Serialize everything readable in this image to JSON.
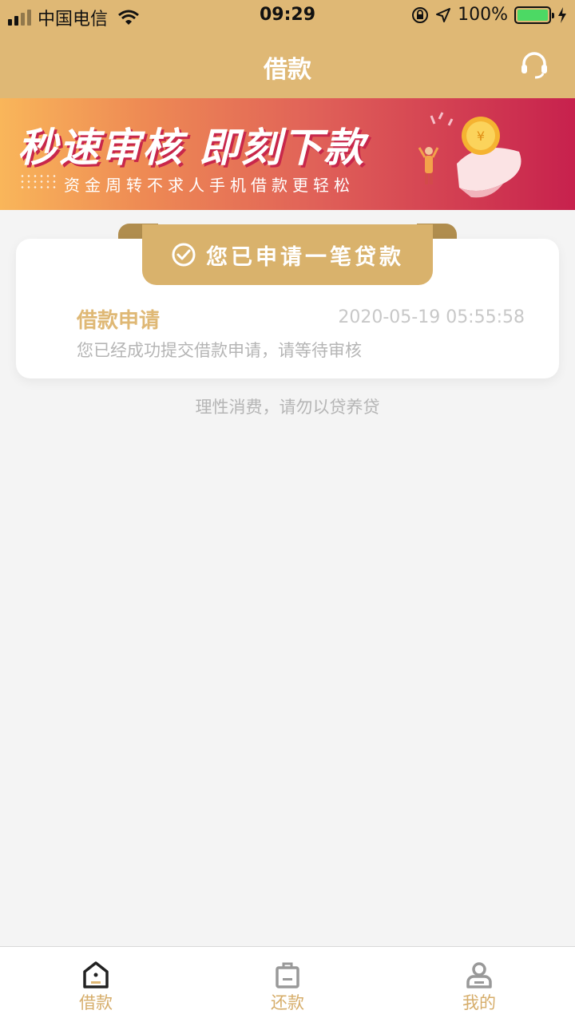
{
  "status_bar": {
    "carrier": "中国电信",
    "time": "09:29",
    "battery": "100%"
  },
  "header": {
    "title": "借款"
  },
  "banner": {
    "title": "秒速审核 即刻下款",
    "subtitle": "资金周转不求人手机借款更轻松"
  },
  "card": {
    "ribbon": "您已申请一笔贷款",
    "item_title": "借款申请",
    "item_time": "2020-05-19 05:55:58",
    "item_desc": "您已经成功提交借款申请，请等待审核"
  },
  "notice": "理性消费，请勿以贷养贷",
  "tabbar": [
    {
      "label": "借款",
      "icon": "loan-icon"
    },
    {
      "label": "还款",
      "icon": "repay-icon"
    },
    {
      "label": "我的",
      "icon": "profile-icon"
    }
  ],
  "colors": {
    "brand": "#dfb875",
    "ribbon": "#d9b26c",
    "banner_start": "#f9b65a",
    "banner_end": "#c7214d"
  }
}
